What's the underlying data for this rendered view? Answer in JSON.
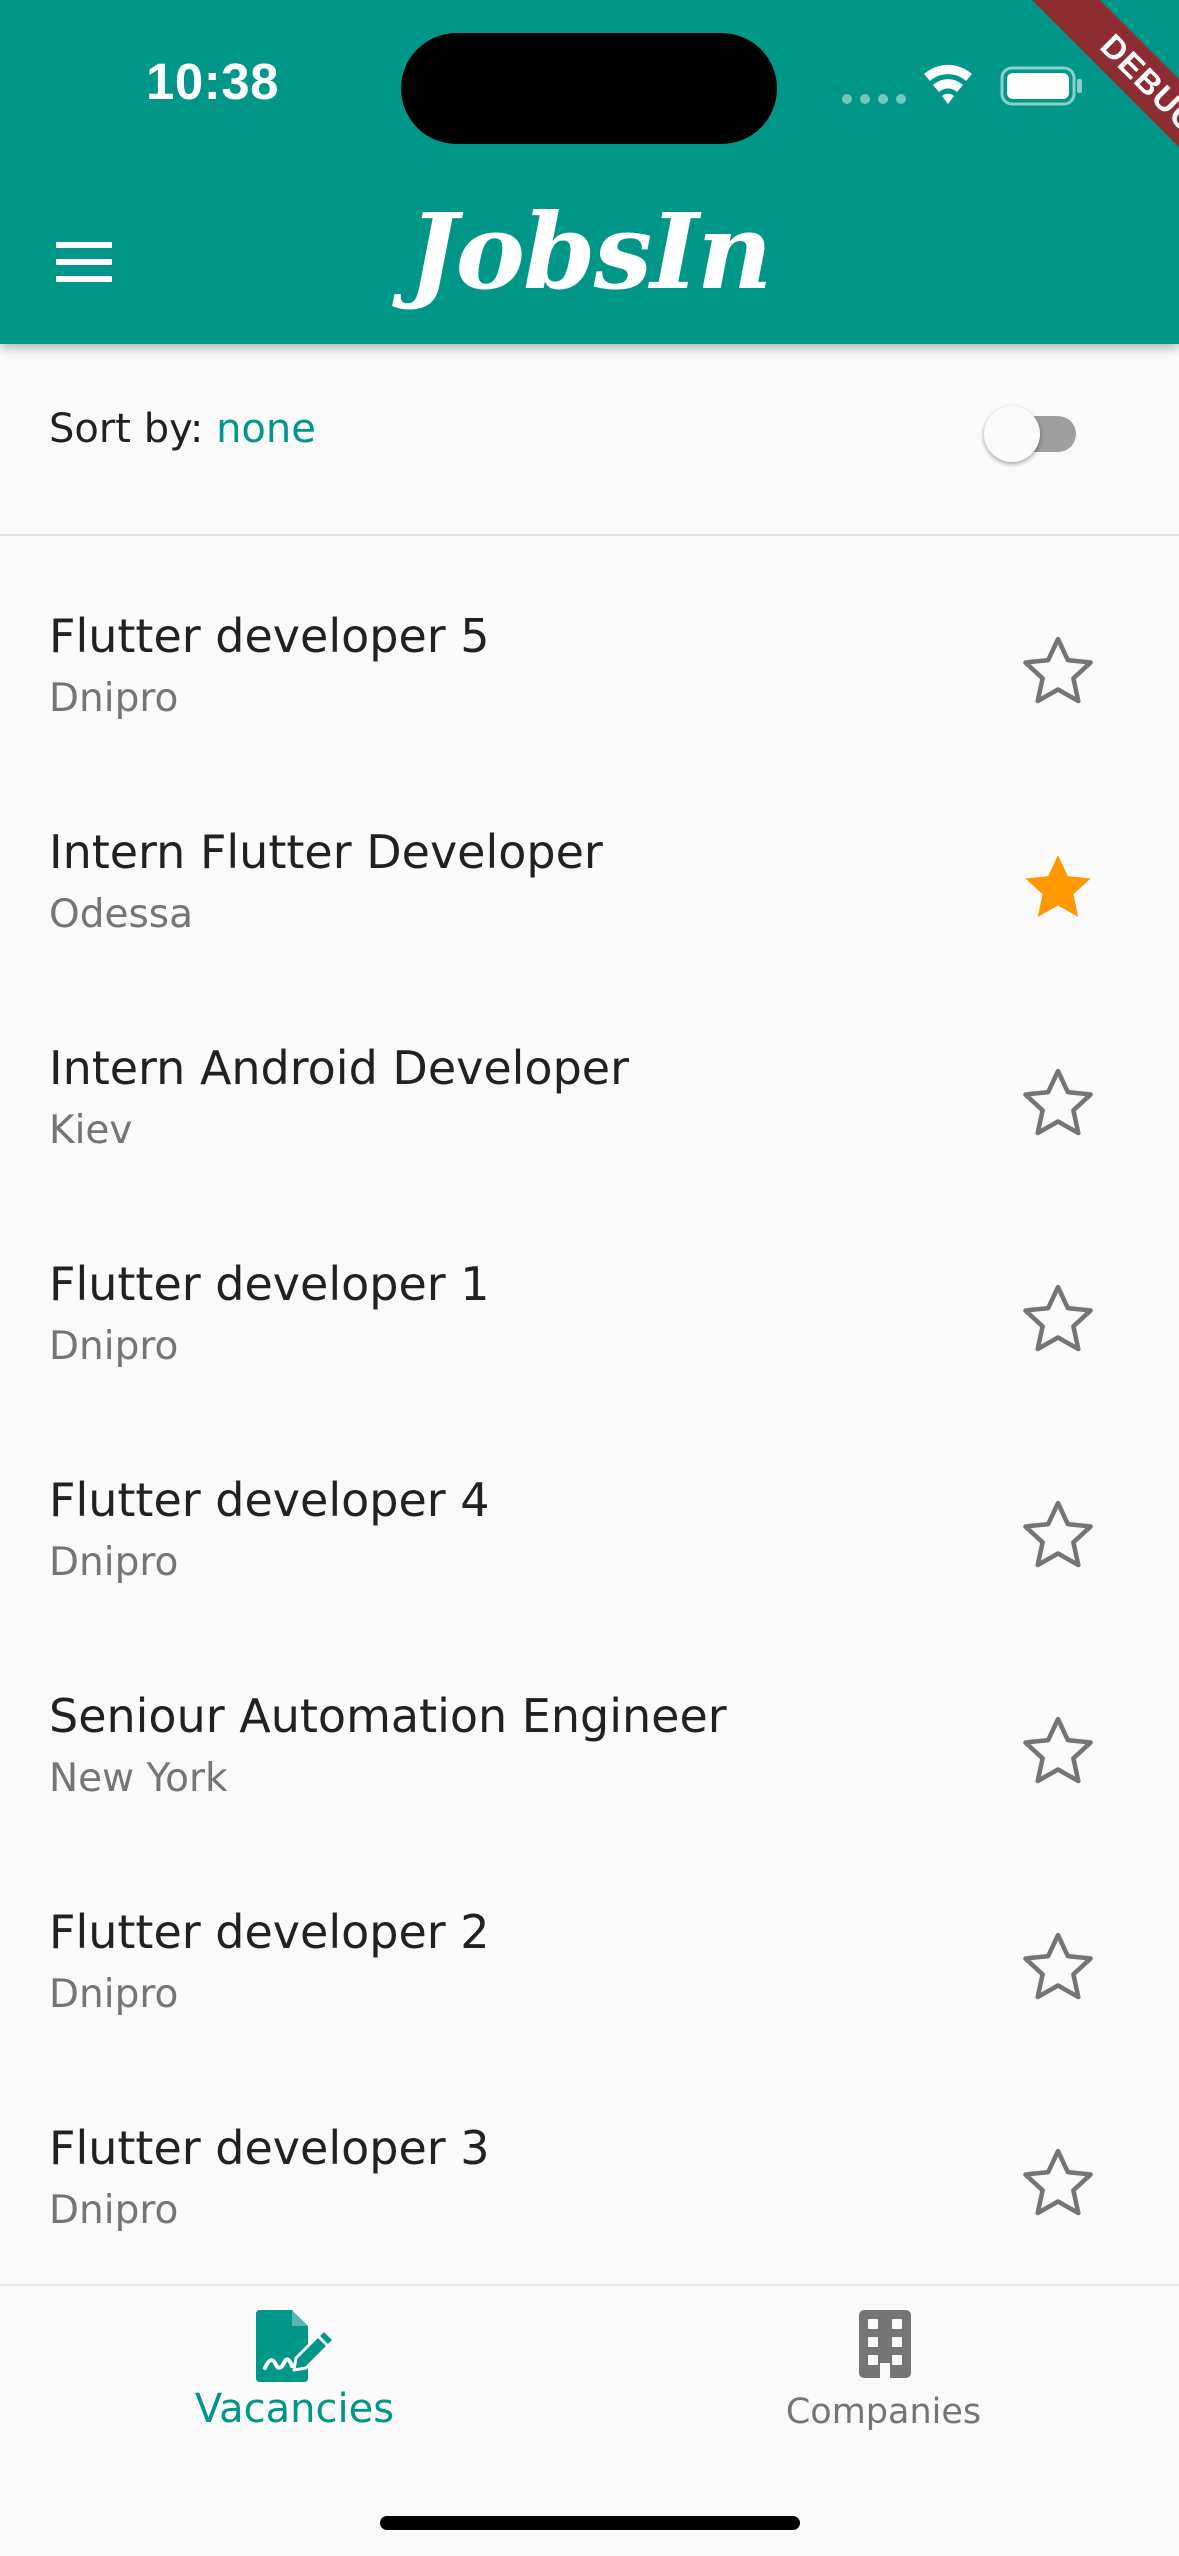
{
  "status_bar": {
    "time": "10:38"
  },
  "debug_banner": "DEBUG",
  "app_bar": {
    "title": "JobsIn"
  },
  "sort": {
    "label": "Sort by:",
    "value": "none",
    "toggle_on": false
  },
  "vacancies": [
    {
      "title": "Flutter developer 5",
      "city": "Dnipro",
      "favorite": false
    },
    {
      "title": "Intern Flutter Developer",
      "city": "Odessa",
      "favorite": true
    },
    {
      "title": "Intern Android Developer",
      "city": "Kiev",
      "favorite": false
    },
    {
      "title": "Flutter developer 1",
      "city": "Dnipro",
      "favorite": false
    },
    {
      "title": "Flutter developer 4",
      "city": "Dnipro",
      "favorite": false
    },
    {
      "title": "Seniour Automation Engineer",
      "city": "New York",
      "favorite": false
    },
    {
      "title": "Flutter developer 2",
      "city": "Dnipro",
      "favorite": false
    },
    {
      "title": "Flutter developer 3",
      "city": "Dnipro",
      "favorite": false
    }
  ],
  "bottom_nav": {
    "tabs": [
      {
        "label": "Vacancies",
        "icon": "signed-document-icon",
        "selected": true
      },
      {
        "label": "Companies",
        "icon": "office-building-icon",
        "selected": false
      }
    ]
  },
  "colors": {
    "primary": "#009688",
    "favorite": "#ff9800",
    "inactive": "#757575",
    "debug": "#8b2d32"
  }
}
